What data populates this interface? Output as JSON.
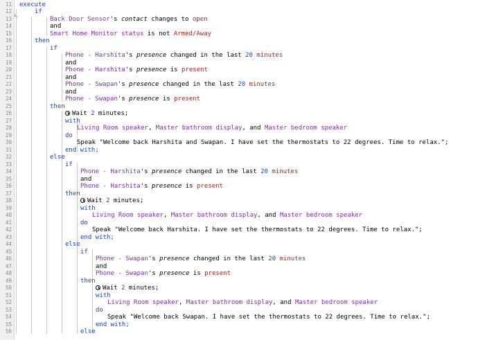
{
  "editor": {
    "marker_glyph": "ϟ",
    "lines": [
      {
        "n": "11",
        "indent": 28,
        "parts": [
          {
            "t": "execute",
            "c": "kw"
          }
        ]
      },
      {
        "n": "12",
        "indent": 50,
        "parts": [
          {
            "t": "if",
            "c": "kw"
          }
        ]
      },
      {
        "n": "13",
        "indent": 72,
        "parts": [
          {
            "t": "Back Door Sensor",
            "c": "dev"
          },
          {
            "t": "'s ",
            "c": ""
          },
          {
            "t": "contact",
            "c": "attr"
          },
          {
            "t": " changes to ",
            "c": ""
          },
          {
            "t": "open",
            "c": "val"
          }
        ]
      },
      {
        "n": "14",
        "indent": 72,
        "parts": [
          {
            "t": "and",
            "c": ""
          }
        ]
      },
      {
        "n": "15",
        "indent": 72,
        "parts": [
          {
            "t": "Smart Home Monitor status",
            "c": "dev"
          },
          {
            "t": " is not ",
            "c": ""
          },
          {
            "t": "Armed/Away",
            "c": "val"
          }
        ]
      },
      {
        "n": "16",
        "indent": 50,
        "parts": [
          {
            "t": "then",
            "c": "kw"
          }
        ]
      },
      {
        "n": "17",
        "indent": 72,
        "parts": [
          {
            "t": "if",
            "c": "kw"
          }
        ]
      },
      {
        "n": "18",
        "indent": 94,
        "parts": [
          {
            "t": "Phone - Harshita",
            "c": "dev"
          },
          {
            "t": "'s ",
            "c": ""
          },
          {
            "t": "presence",
            "c": "attr"
          },
          {
            "t": " changed in the last ",
            "c": ""
          },
          {
            "t": "20",
            "c": "num"
          },
          {
            "t": " minutes",
            "c": "val"
          }
        ]
      },
      {
        "n": "19",
        "indent": 94,
        "parts": [
          {
            "t": "and",
            "c": ""
          }
        ]
      },
      {
        "n": "20",
        "indent": 94,
        "parts": [
          {
            "t": "Phone - Harshita",
            "c": "dev"
          },
          {
            "t": "'s ",
            "c": ""
          },
          {
            "t": "presence",
            "c": "attr"
          },
          {
            "t": " is ",
            "c": ""
          },
          {
            "t": "present",
            "c": "val"
          }
        ]
      },
      {
        "n": "21",
        "indent": 94,
        "parts": [
          {
            "t": "and",
            "c": ""
          }
        ]
      },
      {
        "n": "22",
        "indent": 94,
        "parts": [
          {
            "t": "Phone - Swapan",
            "c": "dev"
          },
          {
            "t": "'s ",
            "c": ""
          },
          {
            "t": "presence",
            "c": "attr"
          },
          {
            "t": " changed in the last ",
            "c": ""
          },
          {
            "t": "20",
            "c": "num"
          },
          {
            "t": " minutes",
            "c": "val"
          }
        ]
      },
      {
        "n": "23",
        "indent": 94,
        "parts": [
          {
            "t": "and",
            "c": ""
          }
        ]
      },
      {
        "n": "24",
        "indent": 94,
        "parts": [
          {
            "t": "Phone - Swapan",
            "c": "dev"
          },
          {
            "t": "'s ",
            "c": ""
          },
          {
            "t": "presence",
            "c": "attr"
          },
          {
            "t": " is ",
            "c": ""
          },
          {
            "t": "present",
            "c": "val"
          }
        ]
      },
      {
        "n": "25",
        "indent": 72,
        "parts": [
          {
            "t": "then",
            "c": "kw"
          }
        ]
      },
      {
        "n": "26",
        "indent": 94,
        "clock": true,
        "parts": [
          {
            "t": "Wait ",
            "c": ""
          },
          {
            "t": "2",
            "c": "num"
          },
          {
            "t": " minutes;",
            "c": ""
          }
        ]
      },
      {
        "n": "27",
        "indent": 94,
        "parts": [
          {
            "t": "with",
            "c": "kw"
          }
        ]
      },
      {
        "n": "28",
        "indent": 111,
        "parts": [
          {
            "t": "Living Room speaker",
            "c": "dev"
          },
          {
            "t": ", ",
            "c": ""
          },
          {
            "t": "Master bathroom display",
            "c": "dev"
          },
          {
            "t": ", and ",
            "c": ""
          },
          {
            "t": "Master bedroom speaker",
            "c": "dev"
          }
        ]
      },
      {
        "n": "29",
        "indent": 94,
        "parts": [
          {
            "t": "do",
            "c": "kw"
          }
        ]
      },
      {
        "n": "30",
        "indent": 111,
        "parts": [
          {
            "t": "Speak ",
            "c": ""
          },
          {
            "t": "\"Welcome back Harshita and Swapan. I have set the thermostats to 22 degrees. Time to relax.\"",
            "c": "str"
          },
          {
            "t": ";",
            "c": ""
          }
        ]
      },
      {
        "n": "31",
        "indent": 94,
        "parts": [
          {
            "t": "end with;",
            "c": "kw"
          }
        ]
      },
      {
        "n": "32",
        "indent": 72,
        "parts": [
          {
            "t": "else",
            "c": "kw"
          }
        ]
      },
      {
        "n": "33",
        "indent": 94,
        "parts": [
          {
            "t": "if",
            "c": "kw"
          }
        ]
      },
      {
        "n": "34",
        "indent": 116,
        "parts": [
          {
            "t": "Phone - Harshita",
            "c": "dev"
          },
          {
            "t": "'s ",
            "c": ""
          },
          {
            "t": "presence",
            "c": "attr"
          },
          {
            "t": " changed in the last ",
            "c": ""
          },
          {
            "t": "20",
            "c": "num"
          },
          {
            "t": " minutes",
            "c": "val"
          }
        ]
      },
      {
        "n": "35",
        "indent": 116,
        "parts": [
          {
            "t": "and",
            "c": ""
          }
        ]
      },
      {
        "n": "36",
        "indent": 116,
        "parts": [
          {
            "t": "Phone - Harshita",
            "c": "dev"
          },
          {
            "t": "'s ",
            "c": ""
          },
          {
            "t": "presence",
            "c": "attr"
          },
          {
            "t": " is ",
            "c": ""
          },
          {
            "t": "present",
            "c": "val"
          }
        ]
      },
      {
        "n": "37",
        "indent": 94,
        "parts": [
          {
            "t": "then",
            "c": "kw"
          }
        ]
      },
      {
        "n": "38",
        "indent": 116,
        "clock": true,
        "parts": [
          {
            "t": "Wait ",
            "c": ""
          },
          {
            "t": "2",
            "c": "num"
          },
          {
            "t": " minutes;",
            "c": ""
          }
        ]
      },
      {
        "n": "39",
        "indent": 116,
        "parts": [
          {
            "t": "with",
            "c": "kw"
          }
        ]
      },
      {
        "n": "40",
        "indent": 133,
        "parts": [
          {
            "t": "Living Room speaker",
            "c": "dev"
          },
          {
            "t": ", ",
            "c": ""
          },
          {
            "t": "Master bathroom display",
            "c": "dev"
          },
          {
            "t": ", and ",
            "c": ""
          },
          {
            "t": "Master bedroom speaker",
            "c": "dev"
          }
        ]
      },
      {
        "n": "41",
        "indent": 116,
        "parts": [
          {
            "t": "do",
            "c": "kw"
          }
        ]
      },
      {
        "n": "42",
        "indent": 133,
        "parts": [
          {
            "t": "Speak ",
            "c": ""
          },
          {
            "t": "\"Welcome back Harshita. I have set the thermostats to 22 degrees. Time to relax.\"",
            "c": "str"
          },
          {
            "t": ";",
            "c": ""
          }
        ]
      },
      {
        "n": "43",
        "indent": 116,
        "parts": [
          {
            "t": "end with;",
            "c": "kw"
          }
        ]
      },
      {
        "n": "44",
        "indent": 94,
        "parts": [
          {
            "t": "else",
            "c": "kw"
          }
        ]
      },
      {
        "n": "45",
        "indent": 116,
        "parts": [
          {
            "t": "if",
            "c": "kw"
          }
        ]
      },
      {
        "n": "46",
        "indent": 138,
        "parts": [
          {
            "t": "Phone - Swapan",
            "c": "dev"
          },
          {
            "t": "'s ",
            "c": ""
          },
          {
            "t": "presence",
            "c": "attr"
          },
          {
            "t": " changed in the last ",
            "c": ""
          },
          {
            "t": "20",
            "c": "num"
          },
          {
            "t": " minutes",
            "c": "val"
          }
        ]
      },
      {
        "n": "47",
        "indent": 138,
        "parts": [
          {
            "t": "and",
            "c": ""
          }
        ]
      },
      {
        "n": "48",
        "indent": 138,
        "parts": [
          {
            "t": "Phone - Swapan",
            "c": "dev"
          },
          {
            "t": "'s ",
            "c": ""
          },
          {
            "t": "presence",
            "c": "attr"
          },
          {
            "t": " is ",
            "c": ""
          },
          {
            "t": "present",
            "c": "val"
          }
        ]
      },
      {
        "n": "49",
        "indent": 116,
        "parts": [
          {
            "t": "then",
            "c": "kw"
          }
        ]
      },
      {
        "n": "50",
        "indent": 138,
        "clock": true,
        "parts": [
          {
            "t": "Wait ",
            "c": ""
          },
          {
            "t": "2",
            "c": "num"
          },
          {
            "t": " minutes;",
            "c": ""
          }
        ]
      },
      {
        "n": "51",
        "indent": 138,
        "parts": [
          {
            "t": "with",
            "c": "kw"
          }
        ]
      },
      {
        "n": "52",
        "indent": 155,
        "parts": [
          {
            "t": "Living Room speaker",
            "c": "dev"
          },
          {
            "t": ", ",
            "c": ""
          },
          {
            "t": "Master bathroom display",
            "c": "dev"
          },
          {
            "t": ", and ",
            "c": ""
          },
          {
            "t": "Master bedroom speaker",
            "c": "dev"
          }
        ]
      },
      {
        "n": "53",
        "indent": 138,
        "parts": [
          {
            "t": "do",
            "c": "kw"
          }
        ]
      },
      {
        "n": "54",
        "indent": 155,
        "parts": [
          {
            "t": "Speak ",
            "c": ""
          },
          {
            "t": "\"Welcome back Swapan. I have set the thermostats to 22 degrees. Time to relax.\"",
            "c": "str"
          },
          {
            "t": ";",
            "c": ""
          }
        ]
      },
      {
        "n": "55",
        "indent": 138,
        "parts": [
          {
            "t": "end with;",
            "c": "kw"
          }
        ]
      },
      {
        "n": "56",
        "indent": 116,
        "parts": [
          {
            "t": "else",
            "c": "kw"
          }
        ]
      }
    ]
  }
}
